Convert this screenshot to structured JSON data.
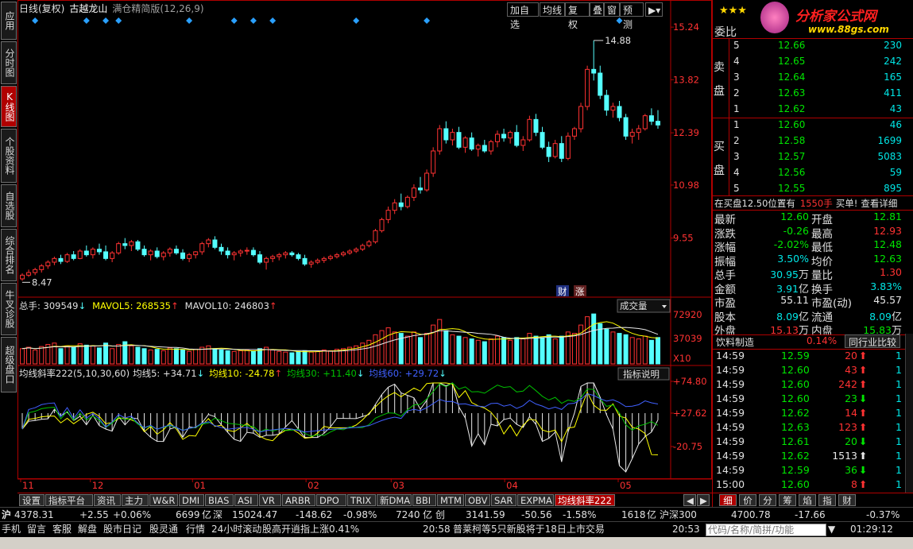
{
  "header": {
    "period": "日线(复权)",
    "stock_name": "古越龙山",
    "indicator": "满仓精简版(12,26,9)",
    "toolbar": [
      "加自选",
      "均线",
      "复权",
      "叠",
      "窗",
      "预测"
    ]
  },
  "left_tabs": [
    "应用",
    "分时图",
    "K线图",
    "个股资料",
    "自选股",
    "综合排名",
    "牛叉诊股",
    "超级盘口"
  ],
  "left_tabs_active": 2,
  "price_axis": [
    "15.24",
    "13.82",
    "12.39",
    "10.98",
    "9.55"
  ],
  "price_annotations": {
    "high": "14.88",
    "low": "8.47"
  },
  "volume_panel": {
    "total_label": "总手: 309549",
    "mavol5_label": "MAVOL5: 268535",
    "mavol10_label": "MAVOL10: 246803",
    "selector": "成交量",
    "axis": [
      "72920",
      "37039",
      "X10"
    ]
  },
  "indicator_panel": {
    "name_label": "均线斜率222(5,10,30,60)",
    "ma5_label": "均线5: +34.71",
    "ma10_label": "均线10: -24.78",
    "ma30_label": "均线30: +11.40",
    "ma60_label": "均线60: +29.72",
    "button": "指标说明",
    "axis": [
      "+74.80",
      "+27.62",
      "-20.75"
    ]
  },
  "month_labels": [
    "11",
    "12",
    "01",
    "02",
    "03",
    "04",
    "05"
  ],
  "badges": [
    "财",
    "涨"
  ],
  "colors": {
    "up": "#ff3232",
    "down": "#54ffff",
    "ma5": "#e8e8e8",
    "ma10": "#ffff00",
    "ma30": "#00c000",
    "ma60": "#4060ff",
    "frame": "#b00000"
  },
  "right_panel": {
    "stars": "★★★",
    "logo_text": "分析家公式网",
    "logo_url": "www.88gs.com",
    "weibi_label": "委比",
    "sell_label": "卖盘",
    "buy_label": "买盘",
    "sell_orders": [
      {
        "lvl": "5",
        "price": "12.66",
        "vol": "230"
      },
      {
        "lvl": "4",
        "price": "12.65",
        "vol": "242"
      },
      {
        "lvl": "3",
        "price": "12.64",
        "vol": "165"
      },
      {
        "lvl": "2",
        "price": "12.63",
        "vol": "411"
      },
      {
        "lvl": "1",
        "price": "12.62",
        "vol": "43"
      }
    ],
    "buy_orders": [
      {
        "lvl": "1",
        "price": "12.60",
        "vol": "46"
      },
      {
        "lvl": "2",
        "price": "12.58",
        "vol": "1699"
      },
      {
        "lvl": "3",
        "price": "12.57",
        "vol": "5083"
      },
      {
        "lvl": "4",
        "price": "12.56",
        "vol": "59"
      },
      {
        "lvl": "5",
        "price": "12.55",
        "vol": "895"
      }
    ],
    "notice": {
      "prefix": "在买盘12.50位置有",
      "amount": "1550手",
      "suffix": "买单!",
      "link": "查看详细"
    },
    "stats": [
      {
        "k1": "最新",
        "v1": "12.60",
        "c1": "green",
        "k2": "开盘",
        "v2": "12.81",
        "c2": "green"
      },
      {
        "k1": "涨跌",
        "v1": "-0.26",
        "c1": "green",
        "k2": "最高",
        "v2": "12.93",
        "c2": "red"
      },
      {
        "k1": "涨幅",
        "v1": "-2.02%",
        "c1": "green",
        "k2": "最低",
        "v2": "12.48",
        "c2": "green"
      },
      {
        "k1": "振幅",
        "v1": "3.50%",
        "c1": "cyan",
        "k2": "均价",
        "v2": "12.63",
        "c2": "green"
      },
      {
        "k1": "总手",
        "v1": "30.95",
        "u1": "万",
        "c1": "cyan",
        "k2": "量比",
        "v2": "1.30",
        "c2": "red"
      },
      {
        "k1": "金额",
        "v1": "3.91",
        "u1": "亿",
        "c1": "cyan",
        "k2": "换手",
        "v2": "3.83%",
        "c2": "cyan"
      },
      {
        "k1": "市盈",
        "v1": "55.11",
        "c1": "white",
        "k2": "市盈(动)",
        "v2": "45.57",
        "c2": "white"
      },
      {
        "k1": "股本",
        "v1": "8.09",
        "u1": "亿",
        "c1": "cyan",
        "k2": "流通",
        "v2": "8.09",
        "u2": "亿",
        "c2": "cyan"
      },
      {
        "k1": "外盘",
        "v1": "15.13",
        "u1": "万",
        "c1": "red",
        "k2": "内盘",
        "v2": "15.83",
        "u2": "万",
        "c2": "green"
      }
    ],
    "industry": {
      "name": "饮料制造",
      "pct": "0.14%",
      "button": "同行业比较"
    },
    "ticks": [
      {
        "t": "14:59",
        "p": "12.59",
        "pc": "green",
        "v": "20",
        "vc": "red",
        "d": "up",
        "n": "1"
      },
      {
        "t": "14:59",
        "p": "12.60",
        "pc": "green",
        "v": "43",
        "vc": "red",
        "d": "up",
        "n": "1"
      },
      {
        "t": "14:59",
        "p": "12.60",
        "pc": "green",
        "v": "242",
        "vc": "red",
        "d": "up",
        "n": "1"
      },
      {
        "t": "14:59",
        "p": "12.60",
        "pc": "green",
        "v": "23",
        "vc": "green",
        "d": "down",
        "n": "1"
      },
      {
        "t": "14:59",
        "p": "12.62",
        "pc": "green",
        "v": "14",
        "vc": "red",
        "d": "up",
        "n": "1"
      },
      {
        "t": "14:59",
        "p": "12.63",
        "pc": "green",
        "v": "123",
        "vc": "red",
        "d": "up",
        "n": "1"
      },
      {
        "t": "14:59",
        "p": "12.61",
        "pc": "green",
        "v": "20",
        "vc": "green",
        "d": "down",
        "n": "1"
      },
      {
        "t": "14:59",
        "p": "12.62",
        "pc": "green",
        "v": "1513",
        "vc": "white",
        "d": "up",
        "n": "1"
      },
      {
        "t": "14:59",
        "p": "12.59",
        "pc": "green",
        "v": "36",
        "vc": "green",
        "d": "down",
        "n": "1"
      },
      {
        "t": "15:00",
        "p": "12.60",
        "pc": "green",
        "v": "8",
        "vc": "red",
        "d": "up",
        "n": "1"
      }
    ],
    "bottom_tabs": [
      "细",
      "价",
      "分",
      "筹",
      "焰",
      "指",
      "财"
    ]
  },
  "bottom_tabs": [
    "设置",
    "指标平台",
    "资讯",
    "主力",
    "W&R",
    "DMI",
    "BIAS",
    "ASI",
    "VR",
    "ARBR",
    "DPO",
    "TRIX",
    "新DMA",
    "BBI",
    "MTM",
    "OBV",
    "SAR",
    "EXPMA",
    "均线斜率222"
  ],
  "index_bar": {
    "sh_label": "沪",
    "sh_value": "4378.31",
    "sh_chg": "+2.55",
    "sh_pct": "+0.06%",
    "sh_amt": "6699",
    "sh_unit": "亿",
    "sz_label": "深",
    "sz_value": "15024.47",
    "sz_chg": "-148.62",
    "sz_pct": "-0.98%",
    "sz_amt": "7240",
    "sz_unit": "亿",
    "cy_label": "创",
    "cy_value": "3141.59",
    "cy_chg": "-50.56",
    "cy_pct": "-1.58%",
    "cy_amt": "1618",
    "cy_unit": "亿",
    "hs_label": "沪深300",
    "hs_value": "4700.78",
    "hs_chg": "-17.66",
    "hs_pct": "-0.37%"
  },
  "status_bar": {
    "items": [
      "手机",
      "留言",
      "客服",
      "解盘",
      "股市日记",
      "股灵通",
      "行情",
      "24小时滚动"
    ],
    "headline1": "股高开逍指上涨0.41%",
    "time1": "20:58",
    "headline2": "普莱柯等5只新股将于18日上市交易",
    "time2": "20:53",
    "search_placeholder": "代码/名称/简拼/功能",
    "clock": "01:29:12"
  },
  "chart_data": {
    "type": "candlestick",
    "title": "古越龙山",
    "months": [
      "11",
      "12",
      "01",
      "02",
      "03",
      "04",
      "05"
    ],
    "ylim": [
      8.0,
      15.5
    ],
    "candles_ohlc": [
      [
        8.45,
        8.6,
        8.4,
        8.55
      ],
      [
        8.55,
        8.7,
        8.5,
        8.62
      ],
      [
        8.62,
        8.75,
        8.55,
        8.7
      ],
      [
        8.7,
        8.85,
        8.62,
        8.8
      ],
      [
        8.8,
        8.95,
        8.72,
        8.9
      ],
      [
        8.9,
        9.05,
        8.82,
        9.0
      ],
      [
        9.0,
        9.1,
        8.85,
        8.92
      ],
      [
        8.92,
        9.15,
        8.88,
        9.1
      ],
      [
        9.1,
        9.2,
        8.95,
        9.0
      ],
      [
        9.0,
        9.25,
        8.98,
        9.2
      ],
      [
        9.2,
        9.35,
        9.05,
        9.1
      ],
      [
        9.1,
        9.3,
        9.0,
        9.25
      ],
      [
        9.25,
        9.4,
        9.1,
        9.18
      ],
      [
        9.18,
        9.35,
        8.95,
        9.0
      ],
      [
        9.0,
        9.2,
        8.9,
        9.15
      ],
      [
        9.15,
        9.45,
        9.1,
        9.4
      ],
      [
        9.4,
        9.55,
        9.25,
        9.35
      ],
      [
        9.35,
        9.5,
        9.2,
        9.45
      ],
      [
        9.45,
        9.5,
        9.2,
        9.25
      ],
      [
        9.25,
        9.35,
        9.05,
        9.1
      ],
      [
        9.1,
        9.25,
        8.95,
        9.2
      ],
      [
        9.2,
        9.3,
        9.0,
        9.05
      ],
      [
        9.05,
        9.2,
        8.95,
        9.15
      ],
      [
        9.15,
        9.3,
        9.05,
        9.25
      ],
      [
        9.25,
        9.35,
        9.1,
        9.15
      ],
      [
        9.15,
        9.25,
        8.95,
        9.0
      ],
      [
        9.0,
        9.15,
        8.9,
        9.1
      ],
      [
        9.1,
        9.2,
        9.0,
        9.18
      ],
      [
        9.18,
        9.45,
        9.1,
        9.4
      ],
      [
        9.4,
        9.55,
        9.3,
        9.5
      ],
      [
        9.5,
        9.6,
        9.25,
        9.3
      ],
      [
        9.3,
        9.4,
        9.1,
        9.2
      ],
      [
        9.2,
        9.3,
        9.0,
        9.1
      ],
      [
        9.1,
        9.2,
        8.95,
        9.15
      ],
      [
        9.15,
        9.25,
        9.05,
        9.2
      ],
      [
        9.2,
        9.3,
        9.1,
        9.22
      ],
      [
        9.22,
        9.3,
        9.05,
        9.1
      ],
      [
        9.1,
        9.2,
        8.85,
        8.9
      ],
      [
        8.9,
        9.05,
        8.7,
        9.0
      ],
      [
        9.0,
        9.1,
        8.9,
        9.05
      ],
      [
        9.05,
        9.15,
        8.95,
        9.1
      ],
      [
        9.1,
        9.2,
        9.0,
        9.15
      ],
      [
        9.15,
        9.2,
        9.05,
        9.1
      ],
      [
        9.1,
        9.15,
        8.95,
        9.0
      ],
      [
        9.0,
        9.1,
        8.8,
        8.85
      ],
      [
        8.85,
        8.95,
        8.75,
        8.9
      ],
      [
        8.9,
        9.0,
        8.85,
        8.95
      ],
      [
        8.95,
        9.05,
        8.88,
        9.0
      ],
      [
        9.0,
        9.1,
        8.95,
        9.05
      ],
      [
        9.05,
        9.15,
        9.0,
        9.1
      ],
      [
        9.1,
        9.2,
        9.05,
        9.15
      ],
      [
        9.15,
        9.25,
        9.1,
        9.2
      ],
      [
        9.2,
        9.3,
        9.15,
        9.25
      ],
      [
        9.25,
        9.4,
        9.2,
        9.35
      ],
      [
        9.35,
        9.5,
        9.3,
        9.45
      ],
      [
        9.45,
        9.8,
        9.4,
        9.75
      ],
      [
        9.75,
        10.1,
        9.7,
        10.05
      ],
      [
        10.05,
        10.4,
        9.95,
        10.3
      ],
      [
        10.3,
        10.6,
        10.2,
        10.5
      ],
      [
        10.5,
        10.75,
        10.3,
        10.4
      ],
      [
        10.4,
        10.7,
        10.35,
        10.65
      ],
      [
        10.65,
        11.0,
        10.55,
        10.9
      ],
      [
        10.9,
        11.2,
        10.75,
        10.85
      ],
      [
        10.85,
        11.4,
        10.8,
        11.3
      ],
      [
        11.3,
        12.0,
        11.2,
        11.9
      ],
      [
        11.9,
        12.6,
        11.8,
        12.5
      ],
      [
        12.5,
        12.7,
        12.1,
        12.2
      ],
      [
        12.2,
        12.5,
        12.05,
        12.4
      ],
      [
        12.4,
        12.55,
        11.95,
        12.0
      ],
      [
        12.0,
        12.3,
        11.85,
        12.25
      ],
      [
        12.25,
        12.4,
        11.9,
        11.95
      ],
      [
        11.95,
        12.1,
        11.75,
        12.05
      ],
      [
        12.05,
        12.2,
        11.85,
        11.9
      ],
      [
        11.9,
        12.2,
        11.8,
        12.15
      ],
      [
        12.15,
        12.45,
        12.0,
        12.35
      ],
      [
        12.35,
        12.5,
        12.15,
        12.25
      ],
      [
        12.25,
        12.45,
        12.1,
        12.4
      ],
      [
        12.4,
        12.6,
        12.0,
        12.05
      ],
      [
        12.05,
        12.3,
        11.9,
        12.2
      ],
      [
        12.2,
        12.85,
        12.15,
        12.75
      ],
      [
        12.75,
        12.9,
        12.3,
        12.4
      ],
      [
        12.4,
        12.55,
        11.95,
        12.0
      ],
      [
        12.0,
        12.15,
        11.6,
        11.75
      ],
      [
        11.75,
        12.2,
        11.7,
        12.1
      ],
      [
        12.1,
        12.3,
        11.6,
        11.7
      ],
      [
        11.7,
        12.4,
        11.65,
        12.3
      ],
      [
        12.3,
        12.55,
        12.2,
        12.5
      ],
      [
        12.5,
        13.2,
        12.4,
        13.1
      ],
      [
        13.1,
        14.2,
        13.0,
        14.1
      ],
      [
        14.1,
        14.88,
        13.8,
        14.0
      ],
      [
        14.0,
        14.2,
        13.3,
        13.4
      ],
      [
        13.4,
        13.55,
        12.85,
        13.0
      ],
      [
        13.0,
        13.2,
        12.8,
        13.1
      ],
      [
        13.1,
        13.25,
        12.7,
        12.8
      ],
      [
        12.8,
        12.9,
        12.2,
        12.3
      ],
      [
        12.3,
        12.5,
        12.1,
        12.4
      ],
      [
        12.4,
        12.6,
        12.2,
        12.5
      ],
      [
        12.5,
        12.9,
        12.45,
        12.85
      ],
      [
        12.85,
        13.05,
        12.6,
        12.7
      ],
      [
        12.7,
        13.0,
        12.5,
        12.6
      ]
    ],
    "volume": [
      22,
      24,
      20,
      25,
      28,
      30,
      22,
      26,
      24,
      29,
      27,
      26,
      23,
      30,
      22,
      28,
      32,
      26,
      24,
      22,
      20,
      21,
      19,
      23,
      22,
      20,
      18,
      21,
      24,
      26,
      22,
      20,
      19,
      18,
      19,
      20,
      18,
      22,
      24,
      20,
      18,
      17,
      16,
      18,
      19,
      17,
      18,
      20,
      19,
      21,
      22,
      24,
      26,
      30,
      34,
      42,
      48,
      52,
      46,
      44,
      40,
      46,
      38,
      44,
      56,
      64,
      48,
      42,
      40,
      38,
      36,
      34,
      32,
      36,
      40,
      38,
      34,
      38,
      36,
      44,
      40,
      38,
      42,
      36,
      40,
      46,
      44,
      56,
      68,
      72,
      58,
      50,
      46,
      44,
      42,
      38,
      36,
      40,
      34,
      38
    ],
    "volume_axis": [
      "72920",
      "37039",
      "X10"
    ],
    "indicator_axis": [
      "+74.80",
      "+27.62",
      "-20.75"
    ]
  }
}
